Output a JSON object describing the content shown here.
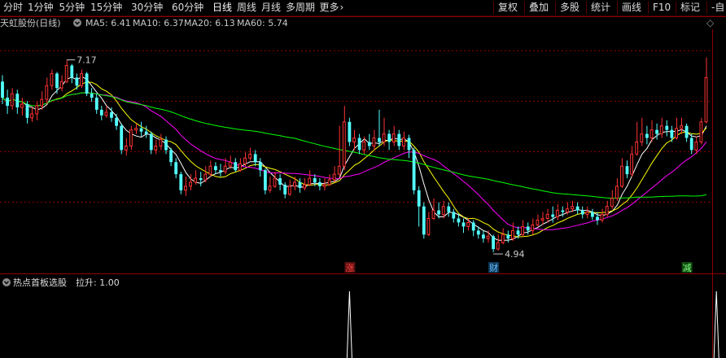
{
  "toolbar": {
    "periods": [
      {
        "label": "分时",
        "active": false
      },
      {
        "label": "1分钟",
        "active": false
      },
      {
        "label": "5分钟",
        "active": false
      },
      {
        "label": "15分钟",
        "active": false
      },
      {
        "label": "30分钟",
        "active": false
      },
      {
        "label": "60分钟",
        "active": false
      },
      {
        "label": "日线",
        "active": true
      },
      {
        "label": "周线",
        "active": false
      },
      {
        "label": "月线",
        "active": false
      },
      {
        "label": "多周期",
        "active": false
      },
      {
        "label": "更多",
        "active": false
      }
    ],
    "right_buttons": [
      "复权",
      "叠加",
      "多股",
      "统计",
      "画线",
      "F10",
      "标记",
      "-自"
    ]
  },
  "chart": {
    "title": "天虹股份(日线)",
    "ma": [
      {
        "label": "MA5: 6.41",
        "color": "#ffffff"
      },
      {
        "label": "MA10: 6.37",
        "color": "#ffff00"
      },
      {
        "label": "MA20: 6.13",
        "color": "#ff00ff"
      },
      {
        "label": "MA60: 5.74",
        "color": "#00ff00"
      }
    ],
    "high_label": "7.17",
    "low_label": "4.94",
    "markers": [
      {
        "text": "涨",
        "color": "#ff4040",
        "bg": "#5a1010",
        "index": 70
      },
      {
        "text": "财",
        "color": "#66bbff",
        "bg": "#103a5a",
        "index": 99
      },
      {
        "text": "减",
        "color": "#80ff80",
        "bg": "#104a10",
        "index": 138
      }
    ],
    "colors": {
      "up": "#ff3232",
      "down": "#54ffff",
      "grid": "#8c0000"
    }
  },
  "indicator": {
    "label": "热点首板选股",
    "value_label": "拉升: 1.00",
    "spike_indices": [
      70,
      144
    ]
  },
  "chart_data": {
    "type": "candlestick",
    "ylim": [
      4.7,
      7.55
    ],
    "candles": [
      [
        6.9,
        6.7,
        6.98,
        6.62
      ],
      [
        6.7,
        6.6,
        6.8,
        6.5
      ],
      [
        6.6,
        6.75,
        6.82,
        6.55
      ],
      [
        6.75,
        6.58,
        6.8,
        6.5
      ],
      [
        6.58,
        6.62,
        6.7,
        6.48
      ],
      [
        6.62,
        6.45,
        6.66,
        6.38
      ],
      [
        6.45,
        6.5,
        6.58,
        6.4
      ],
      [
        6.5,
        6.6,
        6.65,
        6.42
      ],
      [
        6.6,
        6.68,
        6.78,
        6.55
      ],
      [
        6.68,
        6.85,
        6.95,
        6.62
      ],
      [
        6.85,
        7.0,
        7.05,
        6.8
      ],
      [
        7.0,
        6.82,
        7.02,
        6.75
      ],
      [
        6.82,
        6.9,
        6.98,
        6.78
      ],
      [
        6.9,
        7.1,
        7.17,
        6.88
      ],
      [
        7.1,
        6.95,
        7.12,
        6.88
      ],
      [
        6.95,
        6.85,
        7.0,
        6.8
      ],
      [
        6.85,
        7.0,
        7.05,
        6.82
      ],
      [
        7.0,
        6.75,
        7.02,
        6.72
      ],
      [
        6.75,
        6.7,
        6.82,
        6.65
      ],
      [
        6.7,
        6.55,
        6.75,
        6.5
      ],
      [
        6.55,
        6.48,
        6.6,
        6.42
      ],
      [
        6.48,
        6.52,
        6.6,
        6.45
      ],
      [
        6.52,
        6.45,
        6.58,
        6.4
      ],
      [
        6.45,
        6.35,
        6.5,
        6.3
      ],
      [
        6.35,
        6.05,
        6.38,
        6.0
      ],
      [
        6.05,
        6.1,
        6.2,
        5.98
      ],
      [
        6.1,
        6.3,
        6.35,
        6.05
      ],
      [
        6.3,
        6.32,
        6.38,
        6.25
      ],
      [
        6.32,
        6.28,
        6.4,
        6.22
      ],
      [
        6.28,
        6.25,
        6.35,
        6.2
      ],
      [
        6.25,
        6.05,
        6.28,
        6.0
      ],
      [
        6.05,
        6.1,
        6.18,
        6.0
      ],
      [
        6.1,
        6.18,
        6.25,
        6.05
      ],
      [
        6.18,
        6.05,
        6.22,
        6.0
      ],
      [
        6.05,
        5.9,
        6.08,
        5.85
      ],
      [
        5.9,
        5.75,
        5.95,
        5.7
      ],
      [
        5.75,
        5.55,
        5.78,
        5.5
      ],
      [
        5.55,
        5.6,
        5.72,
        5.48
      ],
      [
        5.6,
        5.65,
        5.75,
        5.55
      ],
      [
        5.65,
        5.7,
        5.8,
        5.62
      ],
      [
        5.7,
        5.68,
        5.78,
        5.6
      ],
      [
        5.68,
        5.75,
        5.85,
        5.65
      ],
      [
        5.75,
        5.85,
        5.92,
        5.72
      ],
      [
        5.85,
        5.8,
        5.9,
        5.75
      ],
      [
        5.8,
        5.78,
        5.88,
        5.72
      ],
      [
        5.78,
        5.85,
        5.95,
        5.75
      ],
      [
        5.85,
        5.9,
        5.98,
        5.82
      ],
      [
        5.9,
        5.8,
        5.95,
        5.78
      ],
      [
        5.8,
        5.88,
        5.95,
        5.78
      ],
      [
        5.88,
        5.95,
        6.02,
        5.85
      ],
      [
        5.95,
        6.0,
        6.08,
        5.92
      ],
      [
        6.0,
        5.9,
        6.05,
        5.85
      ],
      [
        5.9,
        5.8,
        5.95,
        5.72
      ],
      [
        5.8,
        5.55,
        5.82,
        5.5
      ],
      [
        5.55,
        5.6,
        5.72,
        5.52
      ],
      [
        5.6,
        5.7,
        5.78,
        5.58
      ],
      [
        5.7,
        5.62,
        5.75,
        5.55
      ],
      [
        5.62,
        5.5,
        5.65,
        5.45
      ],
      [
        5.5,
        5.6,
        5.68,
        5.48
      ],
      [
        5.6,
        5.65,
        5.72,
        5.55
      ],
      [
        5.65,
        5.58,
        5.7,
        5.52
      ],
      [
        5.58,
        5.62,
        5.7,
        5.55
      ],
      [
        5.62,
        5.7,
        5.8,
        5.6
      ],
      [
        5.7,
        5.65,
        5.75,
        5.6
      ],
      [
        5.65,
        5.6,
        5.7,
        5.55
      ],
      [
        5.6,
        5.62,
        5.7,
        5.55
      ],
      [
        5.62,
        5.68,
        5.75,
        5.6
      ],
      [
        5.68,
        5.75,
        5.85,
        5.65
      ],
      [
        5.75,
        5.85,
        6.35,
        5.72
      ],
      [
        5.85,
        6.4,
        6.6,
        5.8
      ],
      [
        6.4,
        6.15,
        6.45,
        6.1
      ],
      [
        6.15,
        6.2,
        6.3,
        6.05
      ],
      [
        6.2,
        6.05,
        6.25,
        6.0
      ],
      [
        6.05,
        6.15,
        6.22,
        6.0
      ],
      [
        6.15,
        6.1,
        6.25,
        6.05
      ],
      [
        6.1,
        6.2,
        6.3,
        6.05
      ],
      [
        6.2,
        6.15,
        6.55,
        6.1
      ],
      [
        6.15,
        6.25,
        6.45,
        6.1
      ],
      [
        6.25,
        6.15,
        6.3,
        6.05
      ],
      [
        6.15,
        6.25,
        6.35,
        6.1
      ],
      [
        6.25,
        6.1,
        6.3,
        6.05
      ],
      [
        6.1,
        6.2,
        6.28,
        6.05
      ],
      [
        6.2,
        6.05,
        6.24,
        5.95
      ],
      [
        6.05,
        5.55,
        6.08,
        5.5
      ],
      [
        5.55,
        5.35,
        5.6,
        5.1
      ],
      [
        5.35,
        5.0,
        5.4,
        4.95
      ],
      [
        5.0,
        5.2,
        5.28,
        4.98
      ],
      [
        5.2,
        5.3,
        5.45,
        5.18
      ],
      [
        5.3,
        5.25,
        5.4,
        5.2
      ],
      [
        5.25,
        5.35,
        5.42,
        5.2
      ],
      [
        5.35,
        5.28,
        5.4,
        5.22
      ],
      [
        5.28,
        5.2,
        5.32,
        5.15
      ],
      [
        5.2,
        5.15,
        5.26,
        5.1
      ],
      [
        5.15,
        5.1,
        5.2,
        5.02
      ],
      [
        5.1,
        5.15,
        5.2,
        5.05
      ],
      [
        5.15,
        5.05,
        5.18,
        4.98
      ],
      [
        5.05,
        5.0,
        5.1,
        4.95
      ],
      [
        5.0,
        4.95,
        5.05,
        4.9
      ],
      [
        4.95,
        4.98,
        5.05,
        4.9
      ],
      [
        4.98,
        4.82,
        5.0,
        4.78
      ],
      [
        4.82,
        4.9,
        5.0,
        4.8
      ],
      [
        4.9,
        5.0,
        5.08,
        4.88
      ],
      [
        5.0,
        4.95,
        5.05,
        4.9
      ],
      [
        4.95,
        5.05,
        5.15,
        4.92
      ],
      [
        5.05,
        5.0,
        5.1,
        4.95
      ],
      [
        5.0,
        5.1,
        5.18,
        4.98
      ],
      [
        5.1,
        5.05,
        5.15,
        5.0
      ],
      [
        5.05,
        5.12,
        5.2,
        5.0
      ],
      [
        5.12,
        5.18,
        5.25,
        5.1
      ],
      [
        5.18,
        5.2,
        5.28,
        5.12
      ],
      [
        5.2,
        5.25,
        5.32,
        5.15
      ],
      [
        5.25,
        5.22,
        5.35,
        5.15
      ],
      [
        5.22,
        5.3,
        5.38,
        5.18
      ],
      [
        5.3,
        5.28,
        5.35,
        5.22
      ],
      [
        5.28,
        5.32,
        5.4,
        5.25
      ],
      [
        5.32,
        5.35,
        5.42,
        5.28
      ],
      [
        5.35,
        5.3,
        5.4,
        5.25
      ],
      [
        5.3,
        5.25,
        5.35,
        5.2
      ],
      [
        5.25,
        5.28,
        5.35,
        5.2
      ],
      [
        5.28,
        5.22,
        5.32,
        5.18
      ],
      [
        5.22,
        5.18,
        5.28,
        5.12
      ],
      [
        5.18,
        5.25,
        5.32,
        5.15
      ],
      [
        5.25,
        5.35,
        5.42,
        5.22
      ],
      [
        5.35,
        5.45,
        5.55,
        5.32
      ],
      [
        5.45,
        5.6,
        5.7,
        5.42
      ],
      [
        5.6,
        5.85,
        5.95,
        5.58
      ],
      [
        5.85,
        5.75,
        5.92,
        5.7
      ],
      [
        5.75,
        6.0,
        6.1,
        5.72
      ],
      [
        6.0,
        6.15,
        6.4,
        5.98
      ],
      [
        6.15,
        6.25,
        6.45,
        6.1
      ],
      [
        6.25,
        6.2,
        6.35,
        6.12
      ],
      [
        6.2,
        6.3,
        6.42,
        6.15
      ],
      [
        6.3,
        6.25,
        6.38,
        6.18
      ],
      [
        6.25,
        6.35,
        6.45,
        6.2
      ],
      [
        6.35,
        6.3,
        6.42,
        6.22
      ],
      [
        6.3,
        6.2,
        6.35,
        6.15
      ],
      [
        6.2,
        6.32,
        6.45,
        6.18
      ],
      [
        6.32,
        6.35,
        6.45,
        6.25
      ],
      [
        6.35,
        6.2,
        6.38,
        6.15
      ],
      [
        6.2,
        6.05,
        6.25,
        6.0
      ],
      [
        6.05,
        6.15,
        6.22,
        6.0
      ],
      [
        6.15,
        6.4,
        6.45,
        6.12
      ],
      [
        6.4,
        6.95,
        7.2,
        6.38
      ]
    ]
  }
}
